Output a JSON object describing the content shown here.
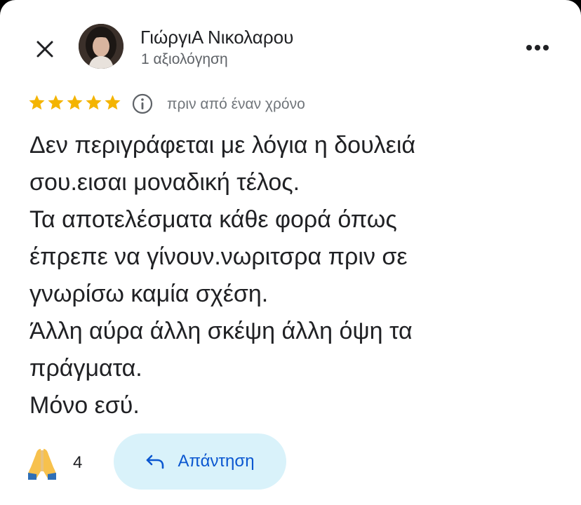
{
  "header": {
    "close_icon": "close-icon",
    "user_name": "ΓιώργιΑ Νικολαρου",
    "review_count": "1 αξιολόγηση",
    "more_icon": "more-horizontal-icon"
  },
  "review": {
    "rating": 5,
    "rating_max": 5,
    "star_color": "#f4b400",
    "info_icon": "info-icon",
    "time": "πριν από έναν χρόνο",
    "lines": [
      "Δεν περιγράφεται με λόγια η δουλειά",
      "σου.εισαι μοναδική τέλος.",
      "Τα αποτελέσματα κάθε φορά όπως",
      "έπρεπε να γίνουν.νωριτσρα πριν σε",
      "γνωρίσω καμία σχέση.",
      "Άλλη αύρα άλλη σκέψη άλλη όψη τα",
      "πράγματα.",
      "Μόνο εσύ."
    ]
  },
  "footer": {
    "reaction_icon": "folded-hands-icon",
    "reaction_count": "4",
    "reply_icon": "reply-arrow-icon",
    "reply_label": "Απάντηση",
    "reply_bg": "#d9f2fa",
    "reply_color": "#0b57d0"
  }
}
